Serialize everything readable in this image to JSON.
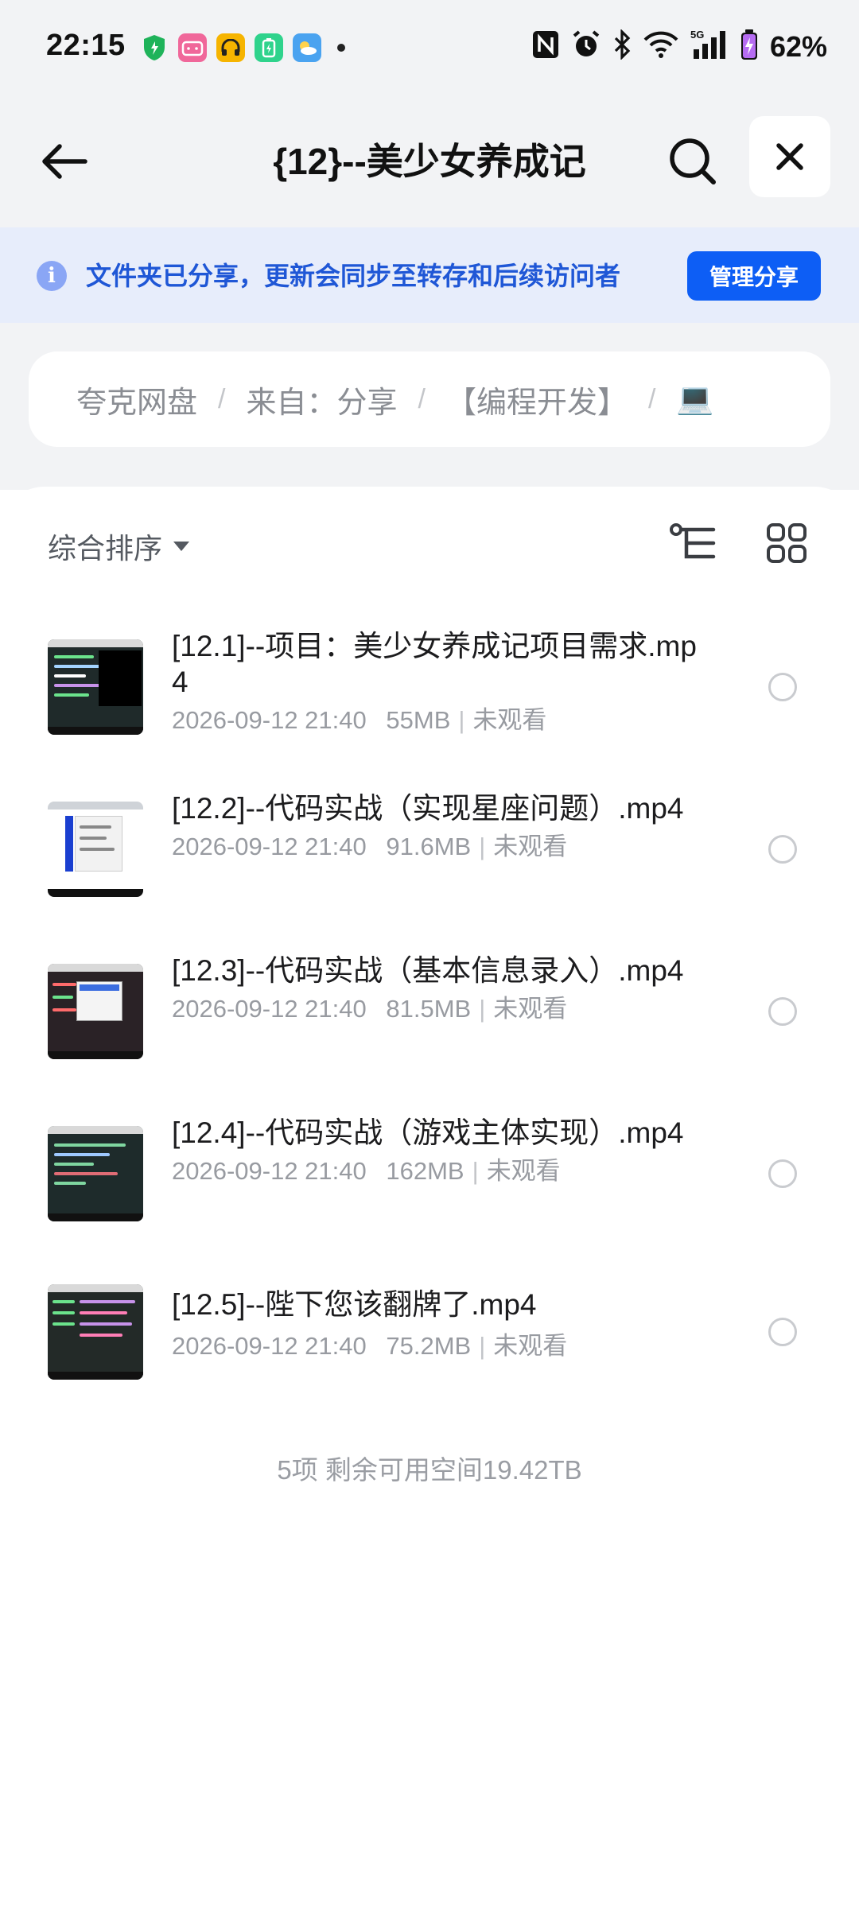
{
  "status_bar": {
    "time": "22:15",
    "battery": "62%",
    "network": "5G"
  },
  "header": {
    "title": "{12}--美少女养成记"
  },
  "share_banner": {
    "text": "文件夹已分享，更新会同步至转存和后续访问者",
    "button_label": "管理分享"
  },
  "breadcrumb": {
    "items": [
      "夸克网盘",
      "来自：分享",
      "【编程开发】",
      "💻"
    ],
    "separator": "/"
  },
  "toolbar": {
    "sort_label": "综合排序"
  },
  "files": [
    {
      "name": "[12.1]--项目：美少女养成记项目需求.mp4",
      "date": "2026-09-12 21:40",
      "size": "55MB",
      "status": "未观看"
    },
    {
      "name": "[12.2]--代码实战（实现星座问题）.mp4",
      "date": "2026-09-12 21:40",
      "size": "91.6MB",
      "status": "未观看"
    },
    {
      "name": "[12.3]--代码实战（基本信息录入）.mp4",
      "date": "2026-09-12 21:40",
      "size": "81.5MB",
      "status": "未观看"
    },
    {
      "name": "[12.4]--代码实战（游戏主体实现）.mp4",
      "date": "2026-09-12 21:40",
      "size": "162MB",
      "status": "未观看"
    },
    {
      "name": "[12.5]--陛下您该翻牌了.mp4",
      "date": "2026-09-12 21:40",
      "size": "75.2MB",
      "status": "未观看"
    }
  ],
  "footer": {
    "summary": "5项 剩余可用空间19.42TB"
  },
  "colors": {
    "accent": "#0d5ef5",
    "banner_bg": "#e7edfb",
    "banner_text": "#1f57d6",
    "page_bg": "#f2f3f5"
  }
}
